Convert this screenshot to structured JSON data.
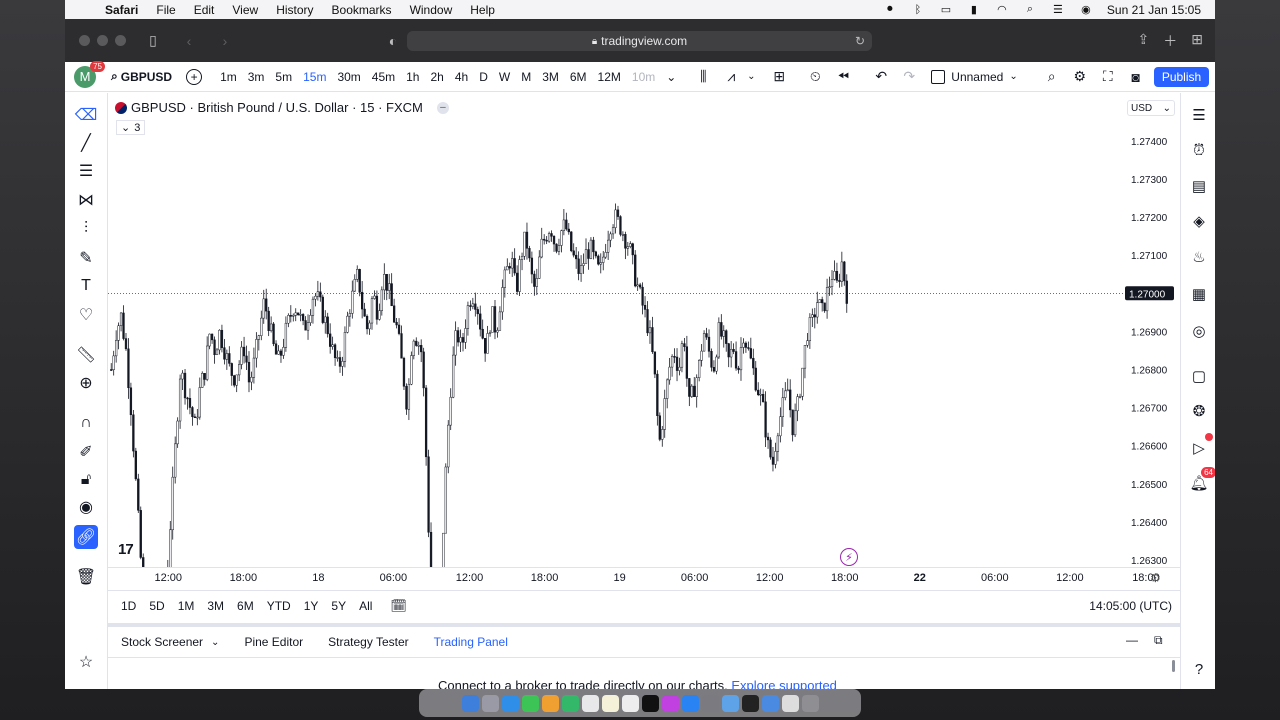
{
  "menubar": {
    "app": "Safari",
    "items": [
      "File",
      "Edit",
      "View",
      "History",
      "Bookmarks",
      "Window",
      "Help"
    ],
    "clock": "Sun 21 Jan  15:05"
  },
  "safari": {
    "url": "tradingview.com"
  },
  "toolbar": {
    "avatar_letter": "M",
    "avatar_badge": "75",
    "symbol": "GBPUSD",
    "timeframes": [
      "1m",
      "3m",
      "5m",
      "15m",
      "30m",
      "45m",
      "1h",
      "2h",
      "4h",
      "D",
      "W",
      "M",
      "3M",
      "6M",
      "12M",
      "10m"
    ],
    "active_timeframe": "15m",
    "muted_timeframe": "10m",
    "layout_name": "Unnamed",
    "publish_label": "Publish"
  },
  "legend": {
    "title": "GBPUSD · British Pound / U.S. Dollar · 15 · FXCM",
    "collapsed_count": "3"
  },
  "price_scale": {
    "currency": "USD",
    "current_price": "1.27000",
    "labels": [
      "1.27400",
      "1.27300",
      "1.27200",
      "1.27100",
      "1.27000",
      "1.26900",
      "1.26800",
      "1.26700",
      "1.26600",
      "1.26500",
      "1.26400",
      "1.26300"
    ]
  },
  "time_axis": {
    "ticks": [
      {
        "label": "12:00",
        "x": 0.018,
        "bold": false
      },
      {
        "label": "18:00",
        "x": 0.088,
        "bold": false
      },
      {
        "label": "18",
        "x": 0.158,
        "bold": false
      },
      {
        "label": "06:00",
        "x": 0.228,
        "bold": false
      },
      {
        "label": "12:00",
        "x": 0.299,
        "bold": false
      },
      {
        "label": "18:00",
        "x": 0.369,
        "bold": false
      },
      {
        "label": "19",
        "x": 0.439,
        "bold": false
      },
      {
        "label": "06:00",
        "x": 0.509,
        "bold": false
      },
      {
        "label": "12:00",
        "x": 0.579,
        "bold": false
      },
      {
        "label": "18:00",
        "x": 0.649,
        "bold": false
      },
      {
        "label": "22",
        "x": 0.719,
        "bold": true
      },
      {
        "label": "06:00",
        "x": 0.789,
        "bold": false
      },
      {
        "label": "12:00",
        "x": 0.859,
        "bold": false
      },
      {
        "label": "18:00",
        "x": 0.93,
        "bold": false
      }
    ]
  },
  "range_bar": {
    "ranges": [
      "1D",
      "5D",
      "1M",
      "3M",
      "6M",
      "YTD",
      "1Y",
      "5Y",
      "All"
    ],
    "clock": "14:05:00 (UTC)"
  },
  "bottom_panel": {
    "tabs": [
      "Stock Screener",
      "Pine Editor",
      "Strategy Tester",
      "Trading Panel"
    ],
    "active_tab": "Trading Panel",
    "message": "Connect to a broker to trade directly on our charts.",
    "message_link": "Explore supported"
  },
  "chart_data": {
    "type": "candlestick",
    "ylim": [
      1.2625,
      1.2745
    ],
    "current_price": 1.27,
    "price_path": [
      1.268,
      1.269,
      1.2694,
      1.2685,
      1.267,
      1.265,
      1.263,
      1.2605,
      1.259,
      1.2585,
      1.26,
      1.262,
      1.264,
      1.266,
      1.268,
      1.2675,
      1.267,
      1.2665,
      1.2675,
      1.268,
      1.269,
      1.2685,
      1.269,
      1.2685,
      1.268,
      1.2678,
      1.2682,
      1.2686,
      1.2676,
      1.2682,
      1.269,
      1.2698,
      1.2692,
      1.2685,
      1.2682,
      1.2688,
      1.2693,
      1.2697,
      1.2695,
      1.269,
      1.2695,
      1.27,
      1.2698,
      1.2694,
      1.269,
      1.2684,
      1.268,
      1.2685,
      1.2695,
      1.27,
      1.2705,
      1.2695,
      1.269,
      1.27,
      1.2695,
      1.2705,
      1.2702,
      1.2695,
      1.269,
      1.268,
      1.267,
      1.269,
      1.2688,
      1.2684,
      1.265,
      1.261,
      1.26,
      1.263,
      1.266,
      1.268,
      1.269,
      1.2685,
      1.2695,
      1.27,
      1.2698,
      1.269,
      1.2685,
      1.2695,
      1.269,
      1.27,
      1.2705,
      1.271,
      1.27,
      1.271,
      1.2715,
      1.2705,
      1.27,
      1.2712,
      1.2715,
      1.2718,
      1.2712,
      1.2716,
      1.2718,
      1.2712,
      1.2708,
      1.2705,
      1.271,
      1.2712,
      1.2708,
      1.2705,
      1.2712,
      1.2718,
      1.272,
      1.2718,
      1.2715,
      1.2712,
      1.2705,
      1.27,
      1.2695,
      1.269,
      1.268,
      1.266,
      1.267,
      1.268,
      1.2685,
      1.268,
      1.269,
      1.267,
      1.2675,
      1.268,
      1.269,
      1.2685,
      1.268,
      1.269,
      1.2688,
      1.2682,
      1.2686,
      1.268,
      1.269,
      1.2685,
      1.268,
      1.2675,
      1.267,
      1.266,
      1.2655,
      1.2665,
      1.267,
      1.2675,
      1.2665,
      1.267,
      1.268,
      1.269,
      1.2692,
      1.2698,
      1.2695,
      1.27,
      1.2705,
      1.2702,
      1.2708,
      1.27
    ]
  },
  "colors": {
    "accent": "#2962ff",
    "candle": "#131722",
    "badge": "#f23645"
  }
}
